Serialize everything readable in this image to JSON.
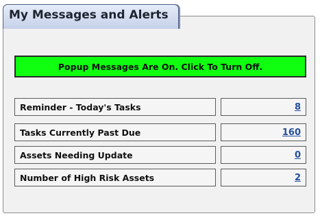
{
  "widget": {
    "title": "My Messages and Alerts"
  },
  "popup_toggle": {
    "label": "Popup Messages Are On. Click To Turn Off.",
    "color": "#10ff10"
  },
  "alerts": [
    {
      "label": "Reminder - Today's Tasks",
      "value": "8"
    },
    {
      "label": "Tasks Currently Past Due",
      "value": "160"
    },
    {
      "label": "Assets Needing Update",
      "value": "0"
    },
    {
      "label": "Number of High Risk Assets",
      "value": "2"
    }
  ]
}
